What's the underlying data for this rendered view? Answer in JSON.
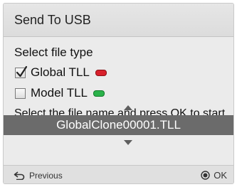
{
  "dialog": {
    "title": "Send To USB"
  },
  "file_type": {
    "label": "Select file type",
    "options": [
      {
        "label": "Global TLL",
        "checked": true,
        "indicator_color": "#d8202b"
      },
      {
        "label": "Model TLL",
        "checked": false,
        "indicator_color": "#2bb24a"
      }
    ]
  },
  "file_name": {
    "instruction": "Select the file name and press OK to start",
    "selected": "GlobalClone00001.TLL"
  },
  "footer": {
    "previous_label": "Previous",
    "ok_label": "OK"
  },
  "icons": [
    "checkmark-icon",
    "arrow-up-icon",
    "arrow-down-icon",
    "back-arrow-icon",
    "ok-button-icon"
  ]
}
